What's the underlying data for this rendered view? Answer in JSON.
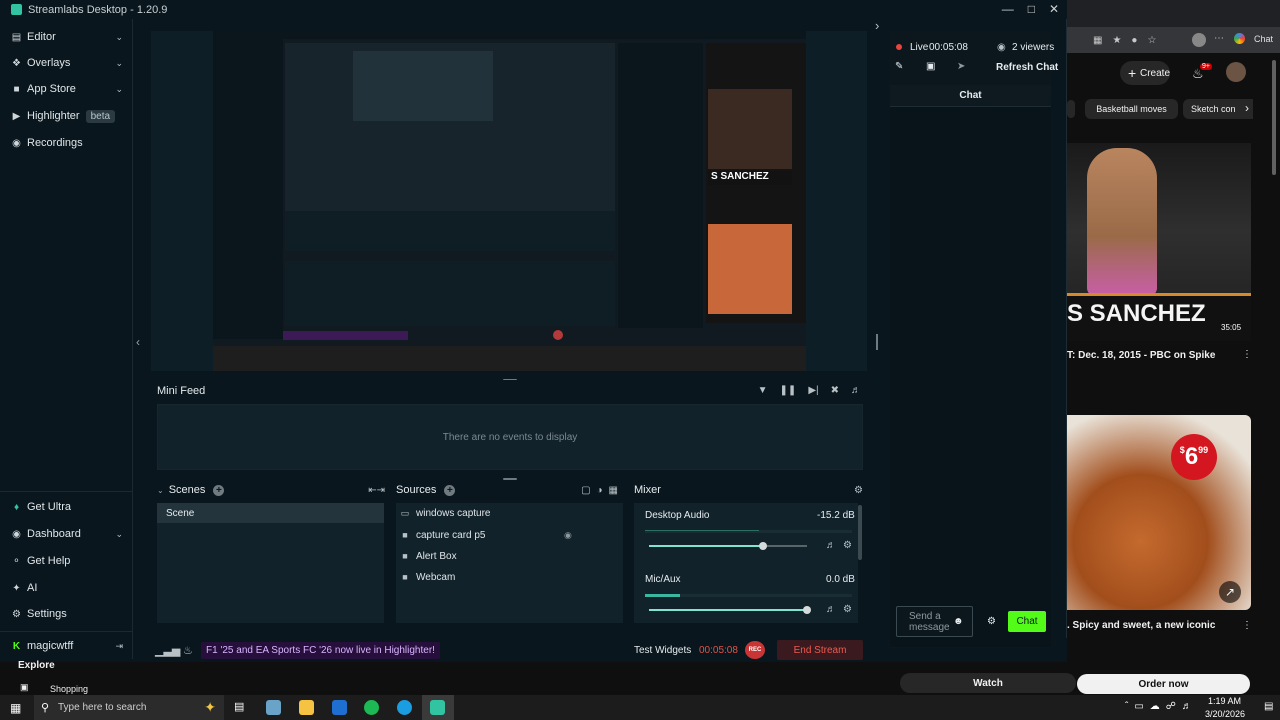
{
  "app": {
    "title": "Streamlabs Desktop - 1.20.9",
    "accent": "#31c3a2"
  },
  "sidebar": {
    "items": [
      {
        "label": "Editor",
        "icon": "editor-icon"
      },
      {
        "label": "Overlays",
        "icon": "overlays-icon"
      },
      {
        "label": "App Store",
        "icon": "app-store-icon"
      },
      {
        "label": "Highlighter",
        "icon": "highlighter-icon",
        "badge": "beta"
      },
      {
        "label": "Recordings",
        "icon": "recordings-icon"
      }
    ],
    "bottom": [
      {
        "label": "Get Ultra",
        "icon": "ultra-icon"
      },
      {
        "label": "Dashboard",
        "icon": "dashboard-icon"
      },
      {
        "label": "Get Help",
        "icon": "help-icon"
      },
      {
        "label": "AI",
        "icon": "ai-icon"
      },
      {
        "label": "Settings",
        "icon": "gear-icon"
      }
    ],
    "user": "magicwtff",
    "explore": "Explore",
    "shopping": "Shopping"
  },
  "minifeed": {
    "title": "Mini Feed",
    "empty": "There are no events to display"
  },
  "scenes": {
    "title": "Scenes",
    "items": [
      "Scene"
    ]
  },
  "sources": {
    "title": "Sources",
    "items": [
      "windows capture",
      "capture card p5",
      "Alert Box",
      "Webcam"
    ]
  },
  "mixer": {
    "title": "Mixer",
    "channels": [
      {
        "name": "Desktop Audio",
        "db": "-15.2 dB",
        "level": 0.72
      },
      {
        "name": "Mic/Aux",
        "db": "0.0 dB",
        "level": 1.0
      }
    ]
  },
  "footer": {
    "promo": "F1 '25 and EA Sports FC '26 now live in Highlighter!",
    "test_widgets": "Test Widgets",
    "timer": "00:05:08",
    "rec": "REC",
    "end_stream": "End Stream"
  },
  "chat": {
    "live": "Live",
    "live_time": "00:05:08",
    "viewers": "2 viewers",
    "refresh": "Refresh Chat",
    "title": "Chat",
    "placeholder": "Send a message",
    "send": "Chat",
    "watch": "Watch"
  },
  "preview": {
    "chips": [
      "Basketball moves",
      "Sketch con"
    ],
    "create": "Create",
    "notif_count": "9+",
    "headline": "S SANCHEZ",
    "duration": "35:05",
    "video_title": "T: Dec. 18, 2015 - PBC on Spike",
    "price": "$6.99",
    "price_dollar": "$",
    "price_main": "6",
    "price_cents": "99",
    "ad_title": ". Spicy and sweet, a new iconic",
    "order": "Order now"
  },
  "taskbar": {
    "search_placeholder": "Type here to search",
    "time": "1:19 AM",
    "date": "3/20/2026"
  }
}
